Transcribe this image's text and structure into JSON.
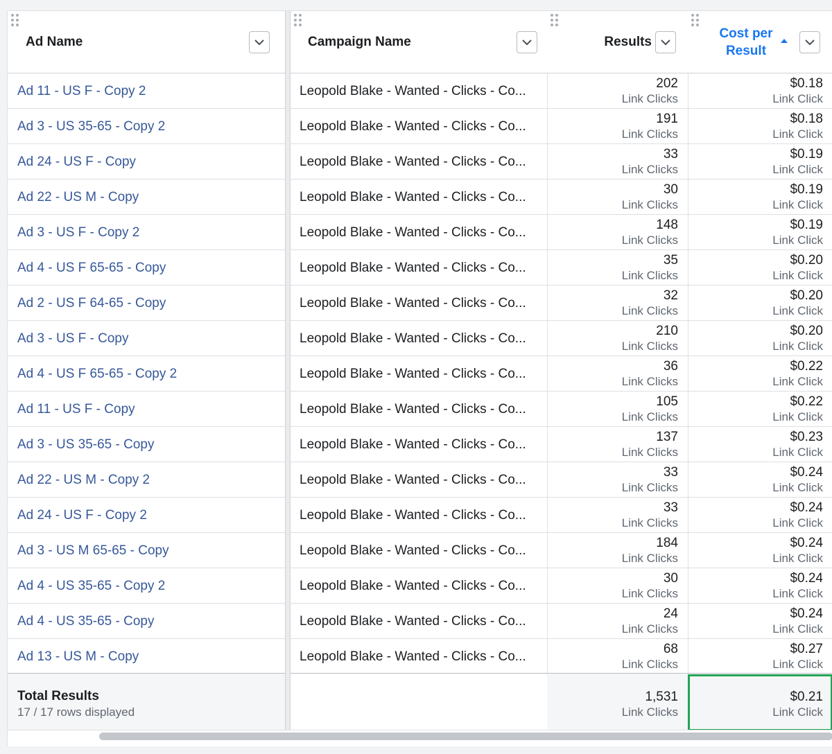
{
  "columns": {
    "ad_name": "Ad Name",
    "campaign_name": "Campaign Name",
    "results": "Results",
    "cost_line1": "Cost per",
    "cost_line2": "Result"
  },
  "rows": [
    {
      "ad": "Ad 11 - US F - Copy 2",
      "campaign": "Leopold Blake - Wanted - Clicks - Co...",
      "results": "202",
      "results_unit": "Link Clicks",
      "cost": "$0.18",
      "cost_unit": "Link Click"
    },
    {
      "ad": "Ad 3 - US 35-65 - Copy 2",
      "campaign": "Leopold Blake - Wanted - Clicks - Co...",
      "results": "191",
      "results_unit": "Link Clicks",
      "cost": "$0.18",
      "cost_unit": "Link Click"
    },
    {
      "ad": "Ad 24 - US F - Copy",
      "campaign": "Leopold Blake - Wanted - Clicks - Co...",
      "results": "33",
      "results_unit": "Link Clicks",
      "cost": "$0.19",
      "cost_unit": "Link Click"
    },
    {
      "ad": "Ad 22 - US M - Copy",
      "campaign": "Leopold Blake - Wanted - Clicks - Co...",
      "results": "30",
      "results_unit": "Link Clicks",
      "cost": "$0.19",
      "cost_unit": "Link Click"
    },
    {
      "ad": "Ad 3 - US F - Copy 2",
      "campaign": "Leopold Blake - Wanted - Clicks - Co...",
      "results": "148",
      "results_unit": "Link Clicks",
      "cost": "$0.19",
      "cost_unit": "Link Click"
    },
    {
      "ad": "Ad 4 - US F 65-65 - Copy",
      "campaign": "Leopold Blake - Wanted - Clicks - Co...",
      "results": "35",
      "results_unit": "Link Clicks",
      "cost": "$0.20",
      "cost_unit": "Link Click"
    },
    {
      "ad": "Ad 2 - US F 64-65 - Copy",
      "campaign": "Leopold Blake - Wanted - Clicks - Co...",
      "results": "32",
      "results_unit": "Link Clicks",
      "cost": "$0.20",
      "cost_unit": "Link Click"
    },
    {
      "ad": "Ad 3 - US F - Copy",
      "campaign": "Leopold Blake - Wanted - Clicks - Co...",
      "results": "210",
      "results_unit": "Link Clicks",
      "cost": "$0.20",
      "cost_unit": "Link Click"
    },
    {
      "ad": "Ad 4 - US F 65-65 - Copy 2",
      "campaign": "Leopold Blake - Wanted - Clicks - Co...",
      "results": "36",
      "results_unit": "Link Clicks",
      "cost": "$0.22",
      "cost_unit": "Link Click"
    },
    {
      "ad": "Ad 11 - US F - Copy",
      "campaign": "Leopold Blake - Wanted - Clicks - Co...",
      "results": "105",
      "results_unit": "Link Clicks",
      "cost": "$0.22",
      "cost_unit": "Link Click"
    },
    {
      "ad": "Ad 3 - US 35-65 - Copy",
      "campaign": "Leopold Blake - Wanted - Clicks - Co...",
      "results": "137",
      "results_unit": "Link Clicks",
      "cost": "$0.23",
      "cost_unit": "Link Click"
    },
    {
      "ad": "Ad 22 - US M - Copy 2",
      "campaign": "Leopold Blake - Wanted - Clicks - Co...",
      "results": "33",
      "results_unit": "Link Clicks",
      "cost": "$0.24",
      "cost_unit": "Link Click"
    },
    {
      "ad": "Ad 24 - US F - Copy 2",
      "campaign": "Leopold Blake - Wanted - Clicks - Co...",
      "results": "33",
      "results_unit": "Link Clicks",
      "cost": "$0.24",
      "cost_unit": "Link Click"
    },
    {
      "ad": "Ad 3 - US M 65-65 - Copy",
      "campaign": "Leopold Blake - Wanted - Clicks - Co...",
      "results": "184",
      "results_unit": "Link Clicks",
      "cost": "$0.24",
      "cost_unit": "Link Click"
    },
    {
      "ad": "Ad 4 - US 35-65 - Copy 2",
      "campaign": "Leopold Blake - Wanted - Clicks - Co...",
      "results": "30",
      "results_unit": "Link Clicks",
      "cost": "$0.24",
      "cost_unit": "Link Click"
    },
    {
      "ad": "Ad 4 - US 35-65 - Copy",
      "campaign": "Leopold Blake - Wanted - Clicks - Co...",
      "results": "24",
      "results_unit": "Link Clicks",
      "cost": "$0.24",
      "cost_unit": "Link Click"
    },
    {
      "ad": "Ad 13 - US M - Copy",
      "campaign": "Leopold Blake - Wanted - Clicks - Co...",
      "results": "68",
      "results_unit": "Link Clicks",
      "cost": "$0.27",
      "cost_unit": "Link Click"
    }
  ],
  "totals": {
    "title": "Total Results",
    "rows_displayed": "17 / 17 rows displayed",
    "results": "1,531",
    "results_unit": "Link Clicks",
    "cost": "$0.21",
    "cost_unit": "Link Click"
  },
  "colors": {
    "link": "#365899",
    "sorted_header": "#1877f2",
    "highlight": "#23a455"
  }
}
